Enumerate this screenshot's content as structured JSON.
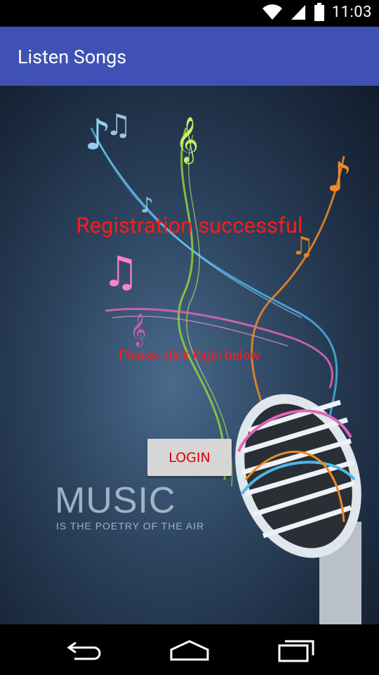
{
  "status_bar": {
    "time": "11:03",
    "icons": [
      "wifi-icon",
      "signal-icon",
      "battery-icon"
    ]
  },
  "app_bar": {
    "title": "Listen Songs",
    "color": "#3f51b5"
  },
  "main": {
    "title_message": "Registration successful",
    "sub_message": "Please click login below",
    "login_label": "LOGIN",
    "message_color": "#ff1a1a",
    "background_image": {
      "heading": "MUSIC",
      "tagline": "IS THE POETRY OF THE AIR"
    }
  },
  "nav_bar": {
    "buttons": [
      "back-icon",
      "home-icon",
      "recents-icon"
    ]
  }
}
